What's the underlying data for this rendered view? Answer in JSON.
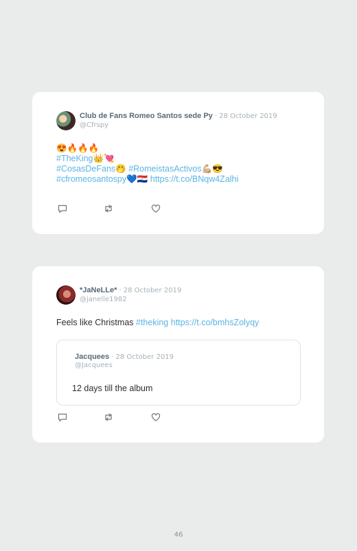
{
  "tweets": [
    {
      "author": "Club de Fans Romeo Santos sede Py",
      "separator": "·",
      "date": "28 October 2019",
      "handle": "@Cfrspy",
      "lines": [
        [
          {
            "t": "😍🔥🔥🔥",
            "link": false
          }
        ],
        [
          {
            "t": "#TheKing",
            "link": true
          },
          {
            "t": "👑💘",
            "link": false
          }
        ],
        [
          {
            "t": "#CosasDeFans",
            "link": true
          },
          {
            "t": "🤭 ",
            "link": false
          },
          {
            "t": "#RomeistasActivos",
            "link": true
          },
          {
            "t": "💪🏼😎",
            "link": false
          }
        ],
        [
          {
            "t": "#cfromeosantospy",
            "link": true
          },
          {
            "t": "💙🇵🇾 ",
            "link": false
          },
          {
            "t": "https://t.co/BNqw4Zalhi",
            "link": true
          }
        ]
      ],
      "actions": [
        "reply-icon",
        "retweet-icon",
        "like-icon"
      ]
    },
    {
      "author": "*JaNeLLe*",
      "separator": "·",
      "date": "28 October 2019",
      "handle": "@janelle1982",
      "lines": [
        [
          {
            "t": "Feels like Christmas ",
            "link": false
          },
          {
            "t": "#theking",
            "link": true
          },
          {
            "t": " ",
            "link": false
          },
          {
            "t": "https://t.co/bmhsZolyqy",
            "link": true
          }
        ]
      ],
      "quote": {
        "author": "Jacquees",
        "separator": "·",
        "date": "28 October 2019",
        "handle": "@Jacquees",
        "text": "12 days till the album"
      },
      "actions": [
        "reply-icon",
        "retweet-icon",
        "like-icon"
      ]
    }
  ],
  "page_number": "46",
  "colors": {
    "background": "#e9eceb",
    "card": "#ffffff",
    "link": "#5ab4e5",
    "name": "#576a78",
    "muted": "#a6b1b8"
  }
}
